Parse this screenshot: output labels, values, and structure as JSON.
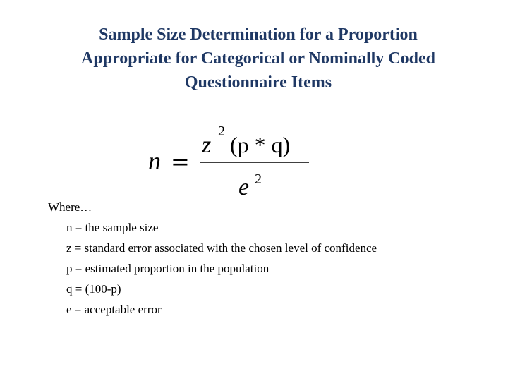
{
  "title": {
    "line1": "Sample Size Determination for a Proportion",
    "line2": "Appropriate for Categorical or Nominally Coded",
    "line3": "Questionnaire Items"
  },
  "formula": {
    "lhs": "n",
    "equals": "=",
    "numerator_var": "z",
    "numerator_exp": "2",
    "numerator_paren": "(p * q)",
    "denominator_var": "e",
    "denominator_exp": "2"
  },
  "definitions": {
    "intro": "Where…",
    "items": [
      "n = the sample size",
      "z = standard error associated with the chosen level of confidence",
      "p = estimated proportion in the population",
      "q = (100-p)",
      "e = acceptable error"
    ]
  },
  "colors": {
    "title": "#1f3864",
    "text": "#000000",
    "background": "#ffffff"
  }
}
